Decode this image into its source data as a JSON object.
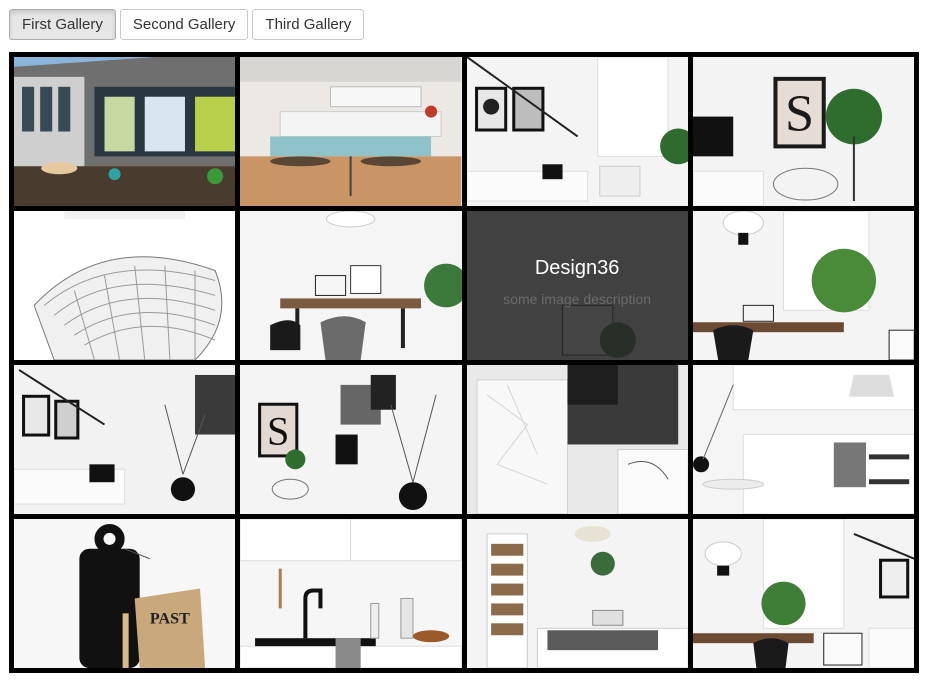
{
  "tabs": [
    {
      "label": "First Gallery",
      "active": true
    },
    {
      "label": "Second Gallery",
      "active": false
    },
    {
      "label": "Third Gallery",
      "active": false
    }
  ],
  "gallery": {
    "hovered_caption": {
      "title": "Design36",
      "description": "some image description"
    }
  }
}
